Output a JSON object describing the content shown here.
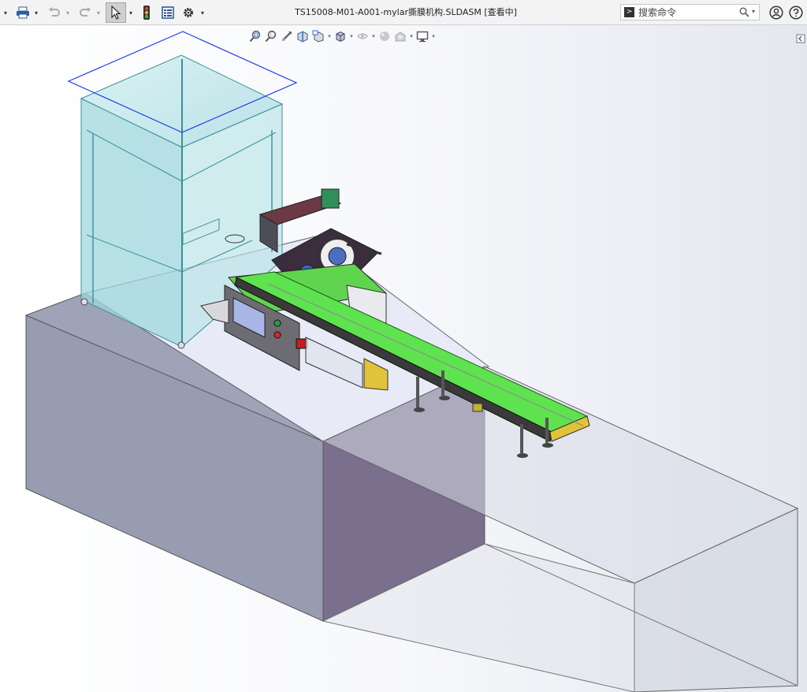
{
  "window": {
    "title": "TS15008-M01-A001-mylar撕膜机构.SLDASM [查看中]"
  },
  "toolbar": {
    "items": [
      {
        "name": "print-icon"
      },
      {
        "name": "undo-icon"
      },
      {
        "name": "redo-icon"
      },
      {
        "name": "select-pointer-icon"
      },
      {
        "name": "traffic-light-icon"
      },
      {
        "name": "file-properties-icon"
      },
      {
        "name": "options-gear-icon"
      }
    ]
  },
  "search": {
    "placeholder": "搜索命令"
  },
  "heads_up_view": {
    "items": [
      {
        "name": "zoom-to-fit-icon"
      },
      {
        "name": "zoom-to-area-icon"
      },
      {
        "name": "previous-view-icon"
      },
      {
        "name": "section-view-icon"
      },
      {
        "name": "dynamic-annotation-view-icon"
      },
      {
        "name": "view-orientation-icon"
      },
      {
        "name": "display-style-icon"
      },
      {
        "name": "hide-show-items-icon"
      },
      {
        "name": "edit-appearance-icon"
      },
      {
        "name": "apply-scene-icon"
      },
      {
        "name": "view-settings-icon"
      }
    ]
  },
  "colors": {
    "toolbar_bg": "#f3f3f3",
    "enclosure_glass": "#8fd3d8",
    "platform_side": "#9a9fb3",
    "platform_dark": "#7a6f8c",
    "conveyor_belt": "#5fe24f",
    "selection_outline": "#1d3df0"
  }
}
